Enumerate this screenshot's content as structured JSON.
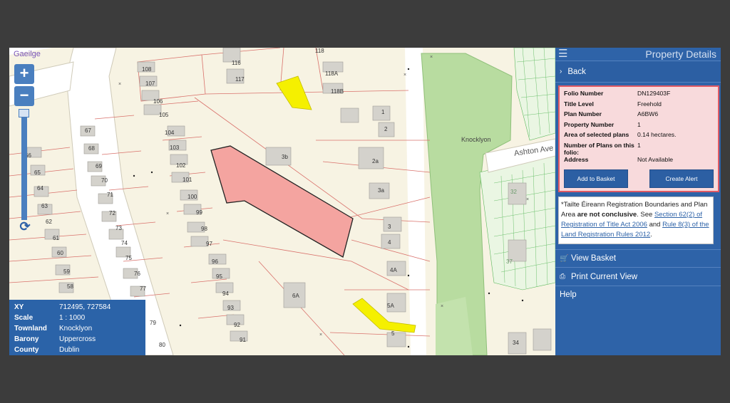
{
  "map": {
    "language_link": "Gaeilge",
    "zoom_in": "+",
    "zoom_out": "−",
    "labels": {
      "houses_a": [
        "108",
        "107",
        "106",
        "105",
        "104",
        "103",
        "102",
        "101",
        "100",
        "99",
        "98",
        "97",
        "96",
        "95",
        "94",
        "93",
        "92",
        "91"
      ],
      "houses_b": [
        "67",
        "68",
        "69",
        "70",
        "71",
        "72",
        "73",
        "74",
        "75",
        "76",
        "77"
      ],
      "houses_c": [
        "66",
        "65",
        "64",
        "63",
        "62",
        "61",
        "60",
        "59",
        "58"
      ],
      "houses_d": [
        "116",
        "117",
        "118",
        "118A",
        "118B"
      ],
      "houses_e": [
        "1",
        "2",
        "2a",
        "3a",
        "3",
        "4",
        "4A",
        "5A",
        "5",
        "6A",
        "3b"
      ],
      "houses_f": [
        "79",
        "80",
        "34",
        "32",
        "37"
      ],
      "place": "Knocklyon",
      "road": "Ashton Ave"
    }
  },
  "info_box": {
    "rows": [
      {
        "k": "XY",
        "v": "712495, 727584"
      },
      {
        "k": "Scale",
        "v": "1 : 1000"
      },
      {
        "k": "Townland",
        "v": "Knocklyon"
      },
      {
        "k": "Barony",
        "v": "Uppercross"
      },
      {
        "k": "County",
        "v": "Dublin"
      }
    ]
  },
  "panel": {
    "title": "Property Details",
    "back": "Back",
    "details": [
      {
        "k": "Folio Number",
        "v": "DN129403F"
      },
      {
        "k": "Title Level",
        "v": "Freehold"
      },
      {
        "k": "Plan Number",
        "v": "A6BW6"
      },
      {
        "k": "Property Number",
        "v": "1"
      },
      {
        "k": "Area of selected plans",
        "v": "0.14 hectares."
      },
      {
        "k": "Number of Plans on this folio:",
        "v": "1"
      },
      {
        "k": "Address",
        "v": "Not Available"
      }
    ],
    "add_basket": "Add to Basket",
    "create_alert": "Create Alert",
    "notice": {
      "pre": "*Tailte Éireann Registration Boundaries and Plan Area ",
      "bold": "are not conclusive",
      "mid": ". See ",
      "link1": "Section 62(2) of Registration of Title Act 2006",
      "and": " and ",
      "link2": "Rule 8(3) of the Land Registration Rules 2012",
      "end": "."
    },
    "menu": {
      "view_basket": "View Basket",
      "print_view": "Print Current View",
      "help": "Help"
    }
  },
  "colors": {
    "panel": "#2e63a8",
    "highlight_plot": "#f4a4a0",
    "yellow_plot": "#f5f000",
    "park": "#b8dca0"
  }
}
